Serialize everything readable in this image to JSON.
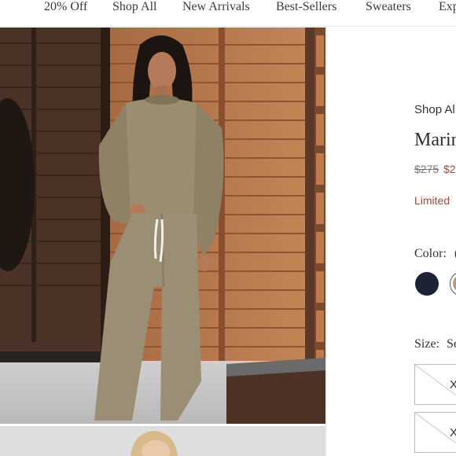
{
  "nav": {
    "items": [
      "20% Off",
      "Shop All",
      "New Arrivals",
      "Best-Sellers",
      "Sweaters",
      "Exp"
    ]
  },
  "product": {
    "breadcrumb": "Shop Al",
    "title": "Marin",
    "price_original": "$275",
    "price_sale": "$2",
    "limited_text": "Limited",
    "color_label": "Color:",
    "color_value": "(",
    "size_label": "Size:",
    "size_value": "Se",
    "sizes": [
      "X",
      "X"
    ]
  },
  "colors": {
    "swatch_navy": "#1e2235",
    "swatch_taupe": "#b39a80",
    "sale_red": "#a0453b"
  }
}
